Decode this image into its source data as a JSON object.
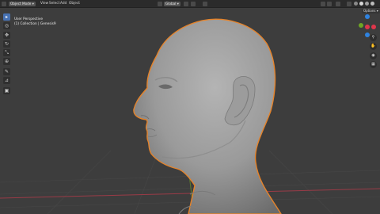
{
  "menu": {
    "object_mode": "Object Mode",
    "items": [
      "View",
      "Select",
      "Add",
      "Object"
    ]
  },
  "header_right": {
    "transform": "Global",
    "options": "Options"
  },
  "viewport": {
    "perspective": "User Perspective",
    "collection": "(1) Collection | Genesis9"
  },
  "gizmo": {
    "x_label": "X",
    "y_label": "Y",
    "z_label": "Z",
    "x_color": "#e0364b",
    "y_color": "#6fa524",
    "z_color": "#2f83e0"
  },
  "colors": {
    "selection_outline": "#e5832a",
    "grid_x_axis": "#9a3b47",
    "grid_y_axis": "#5f7d2e",
    "active_tool": "#4772b3"
  },
  "toolbar": {
    "icons": [
      "select-box-icon",
      "cursor-icon",
      "move-icon",
      "rotate-icon",
      "scale-icon",
      "transform-icon",
      "annotate-icon",
      "measure-icon",
      "add-cube-icon"
    ]
  }
}
